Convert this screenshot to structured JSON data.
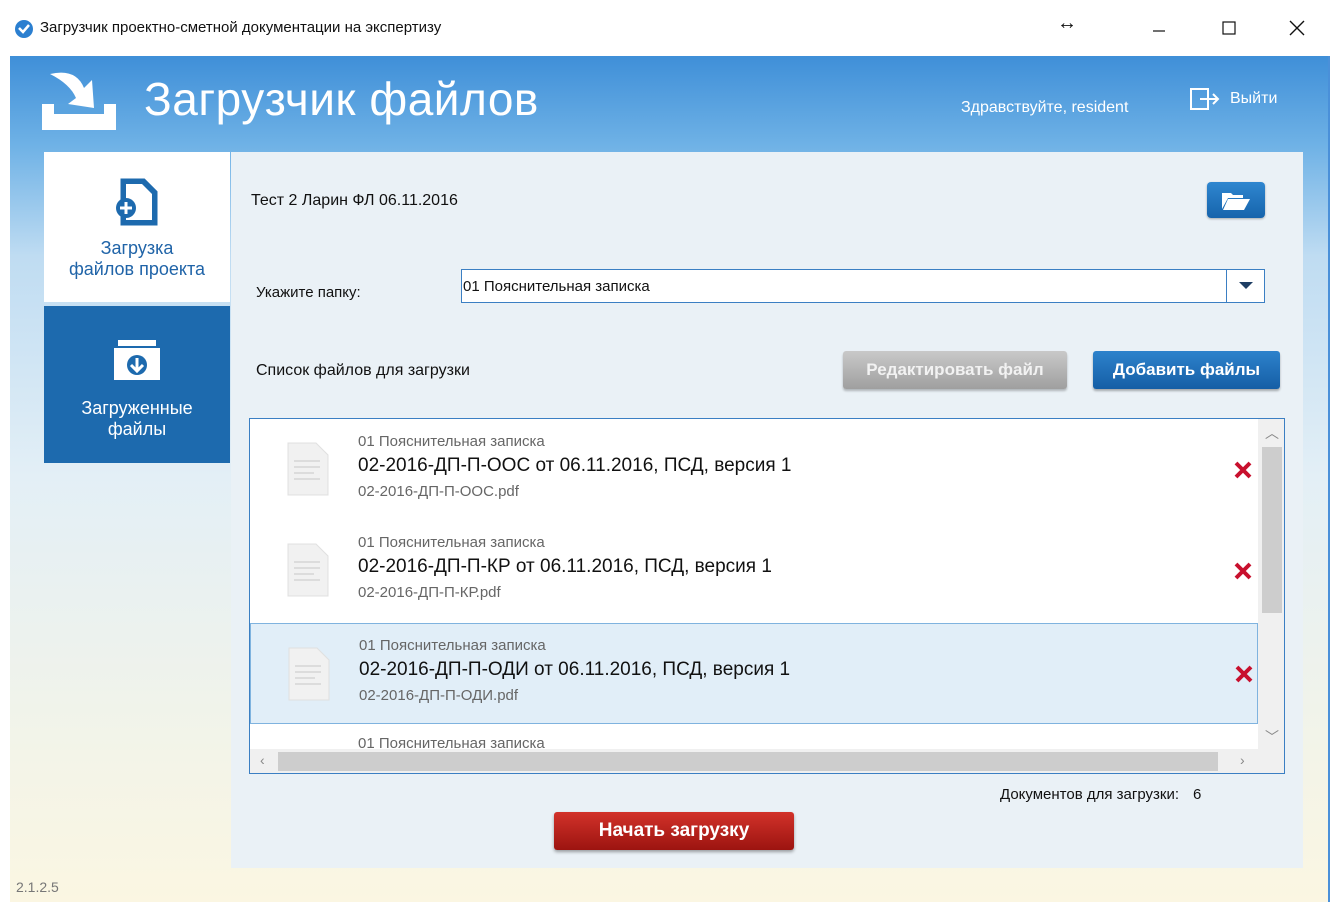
{
  "window": {
    "title": "Загрузчик проектно-сметной документации на экспертизу",
    "resize_glyph": "↔"
  },
  "header": {
    "title": "Загрузчик файлов",
    "greeting": "Здравствуйте, resident",
    "logout_label": "Выйти"
  },
  "sidebar": {
    "items": [
      {
        "label_line1": "Загрузка",
        "label_line2": "файлов проекта",
        "icon": "file-add-icon",
        "active": true
      },
      {
        "label_line1": "Загруженные",
        "label_line2": "файлы",
        "icon": "folder-download-icon",
        "active": false
      }
    ]
  },
  "main": {
    "project_name": "Тест 2 Ларин ФЛ 06.11.2016",
    "folder_label": "Укажите папку:",
    "folder_value": "01 Пояснительная записка",
    "list_label": "Список файлов для загрузки",
    "edit_button": "Редактировать файл",
    "add_button": "Добавить файлы",
    "files": [
      {
        "folder": "01 Пояснительная записка",
        "title": "02-2016-ДП-П-ООС от 06.11.2016, ПСД, версия 1",
        "filename": "02-2016-ДП-П-ООС.pdf",
        "selected": false
      },
      {
        "folder": "01 Пояснительная записка",
        "title": "02-2016-ДП-П-КР от 06.11.2016, ПСД, версия 1",
        "filename": "02-2016-ДП-П-КР.pdf",
        "selected": false
      },
      {
        "folder": "01 Пояснительная записка",
        "title": "02-2016-ДП-П-ОДИ от 06.11.2016, ПСД, версия 1",
        "filename": "02-2016-ДП-П-ОДИ.pdf",
        "selected": true
      },
      {
        "folder": "01 Пояснительная записка",
        "title": "",
        "filename": "",
        "selected": false
      }
    ],
    "doc_count_label": "Документов для загрузки:",
    "doc_count": "6",
    "start_button": "Начать загрузку"
  },
  "version": "2.1.2.5",
  "colors": {
    "accent_blue": "#1d6aae",
    "start_red": "#c0221c",
    "remove_red": "#c8102e"
  }
}
